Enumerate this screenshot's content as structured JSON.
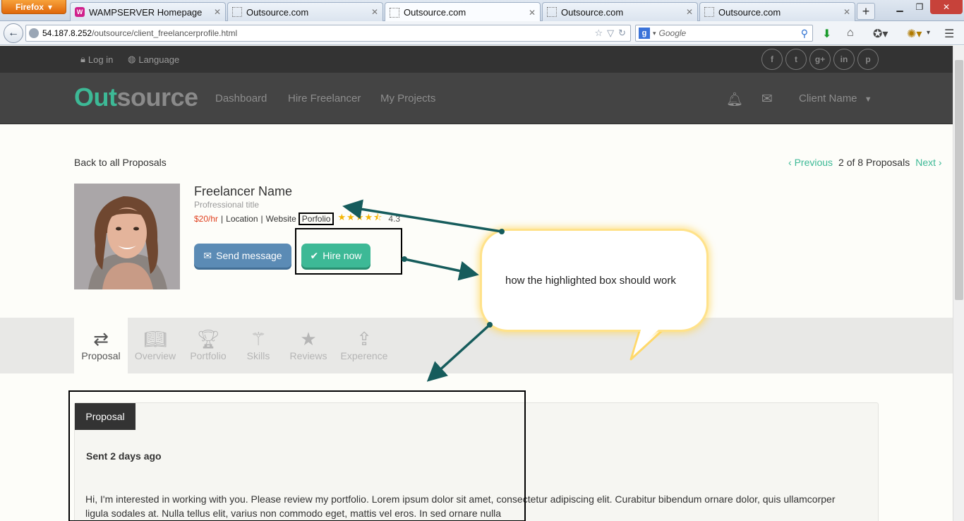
{
  "browser": {
    "menu_label": "Firefox",
    "tabs": [
      {
        "title": "WAMPSERVER Homepage",
        "favicon": "W"
      },
      {
        "title": "Outsource.com"
      },
      {
        "title": "Outsource.com"
      },
      {
        "title": "Outsource.com"
      },
      {
        "title": "Outsource.com"
      }
    ],
    "url_host": "54.187.8.252",
    "url_path": "/outsource/client_freelancerprofile.html",
    "search_placeholder": "Google"
  },
  "site": {
    "top_links": {
      "login": "Log in",
      "language": "Language"
    },
    "social": [
      "f",
      "t",
      "g+",
      "in",
      "p"
    ],
    "logo_part1": "Out",
    "logo_part2": "source",
    "nav": [
      "Dashboard",
      "Hire Freelancer",
      "My Projects"
    ],
    "client_name": "Client Name",
    "accent_color": "#3db996"
  },
  "proposal_nav": {
    "back_label": "Back to all Proposals",
    "previous_label": "Previous",
    "counter": "2 of 8 Proposals",
    "next_label": "Next"
  },
  "freelancer": {
    "name": "Freelancer Name",
    "title": "Profressional title",
    "rate": "$20/hr",
    "location": "Location",
    "website": "Website",
    "portfolio": "Porfolio",
    "rating": "4.3"
  },
  "actions": {
    "send_message": "Send message",
    "hire_now": "Hire now"
  },
  "profile_tabs": [
    {
      "label": "Proposal",
      "icon": "exchange-icon",
      "active": true
    },
    {
      "label": "Overview",
      "icon": "book-icon"
    },
    {
      "label": "Portfolio",
      "icon": "trophy-icon"
    },
    {
      "label": "Skills",
      "icon": "magic-wand-icon"
    },
    {
      "label": "Reviews",
      "icon": "star-icon"
    },
    {
      "label": "Experence",
      "icon": "upload-icon"
    }
  ],
  "proposal": {
    "tab_label": "Proposal",
    "sent": "Sent 2 days ago",
    "text": "Hi, I'm interested in working with you. Please review my portfolio. Lorem ipsum dolor sit amet, consectetur adipiscing elit. Curabitur bibendum ornare dolor, quis ullamcorper ligula sodales at. Nulla tellus elit, varius non commodo eget, mattis vel eros. In sed ornare nulla"
  },
  "annotation": {
    "callout_text": "how the highlighted box should work",
    "arrow_color": "#165c5c"
  }
}
